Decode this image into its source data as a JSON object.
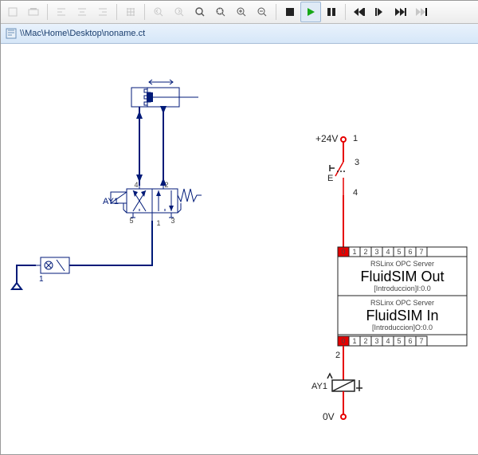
{
  "filepath": "\\\\Mac\\Home\\Desktop\\noname.ct",
  "pneumatic": {
    "valve_label": "AY1",
    "ports": {
      "p1": "1",
      "p2": "2",
      "p3": "3",
      "p4": "4",
      "p5": "5"
    }
  },
  "electric": {
    "supply": "+24V",
    "ground": "0V",
    "node1": "1",
    "node3": "3",
    "switch_label": "E",
    "node4": "4",
    "node2": "2",
    "solenoid_label": "AY1"
  },
  "opc": {
    "out": {
      "server": "RSLinx OPC Server",
      "title": "FluidSIM Out",
      "address": "[Introduccion]I:0.0",
      "ports": [
        "0",
        "1",
        "2",
        "3",
        "4",
        "5",
        "6",
        "7"
      ]
    },
    "in": {
      "server": "RSLinx OPC Server",
      "title": "FluidSIM In",
      "address": "[Introduccion]O:0.0",
      "ports": [
        "0",
        "1",
        "2",
        "3",
        "4",
        "5",
        "6",
        "7"
      ]
    }
  }
}
